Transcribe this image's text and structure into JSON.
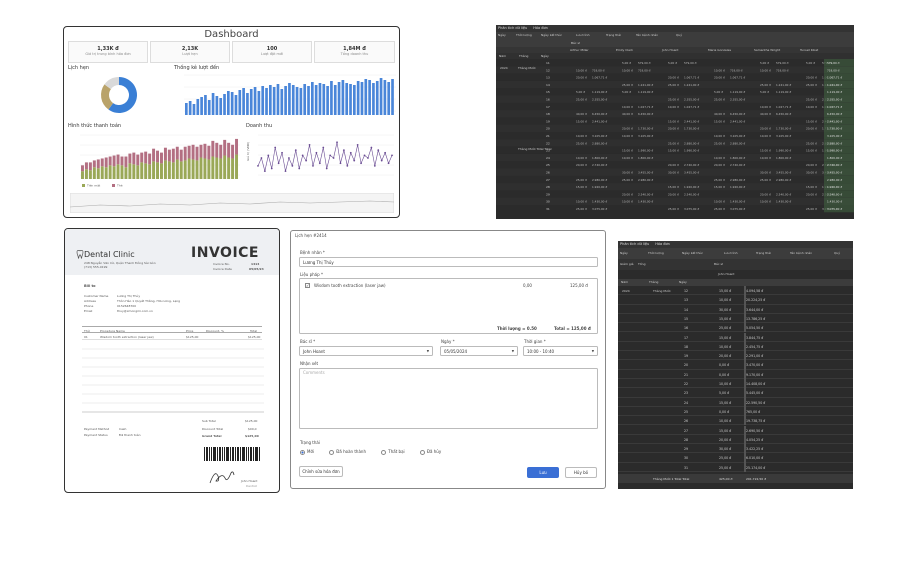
{
  "dashboard": {
    "title": "Dashboard",
    "kpis": [
      {
        "value": "1,33K đ",
        "label": "Giá trị trung bình hóa đơn"
      },
      {
        "value": "2,13K",
        "label": "Lượt hẹn"
      },
      {
        "value": "100",
        "label": "Lượt đặt mới"
      },
      {
        "value": "1,84M đ",
        "label": "Tổng doanh thu"
      }
    ],
    "panels": {
      "appointments": "Lịch hẹn",
      "stats": "Thống kê lượt đến",
      "payment": "Hình thức thanh toán",
      "revenue": "Doanh thu"
    }
  },
  "chart_data": [
    {
      "type": "pie",
      "title": "Lịch hẹn",
      "labels": [
        "",
        "",
        ""
      ],
      "values": [
        0.6,
        0.25,
        0.15
      ],
      "colors": [
        "#3a7fd5",
        "#b9a36a",
        "#d9d9d9"
      ]
    },
    {
      "type": "bar",
      "title": "Thống kê lượt đến",
      "values": [
        12,
        14,
        11,
        16,
        18,
        20,
        15,
        22,
        19,
        17,
        21,
        24,
        23,
        20,
        25,
        27,
        22,
        26,
        28,
        24,
        29,
        27,
        30,
        28,
        31,
        26,
        29,
        32,
        30,
        28,
        27,
        31,
        29,
        33,
        30,
        32,
        31,
        29,
        34,
        30,
        33,
        35,
        32,
        31,
        30,
        34,
        33,
        36,
        35,
        32,
        34,
        37,
        35,
        33,
        36
      ],
      "colors": [
        "#4a86d9"
      ]
    },
    {
      "type": "bar",
      "title": "Hình thức thanh toán",
      "series": [
        {
          "name": "Tiền mặt",
          "values": [
            8,
            10,
            9,
            12,
            11,
            13,
            12,
            14,
            13,
            15,
            14,
            12,
            16,
            15,
            14,
            17,
            16,
            15,
            18,
            17,
            16,
            19,
            18,
            17,
            20,
            18,
            19,
            21,
            20,
            19,
            22,
            21,
            20,
            23,
            22,
            21,
            24,
            22,
            21,
            25
          ]
        },
        {
          "name": "Thẻ",
          "values": [
            6,
            7,
            8,
            7,
            9,
            8,
            10,
            9,
            11,
            10,
            9,
            11,
            10,
            12,
            11,
            10,
            12,
            11,
            13,
            12,
            11,
            13,
            12,
            14,
            13,
            12,
            14,
            13,
            15,
            14,
            13,
            15,
            14,
            16,
            15,
            14,
            16,
            15,
            14,
            16
          ]
        }
      ],
      "colors": [
        "#9aa857",
        "#b36f82"
      ]
    },
    {
      "type": "line",
      "title": "Doanh thu",
      "ylabel": "Giá trị (VND)",
      "series": [
        {
          "name": "",
          "values": [
            5,
            8,
            3,
            9,
            4,
            12,
            6,
            10,
            3,
            8,
            5,
            11,
            4,
            9,
            7,
            13,
            5,
            10,
            6,
            12,
            4,
            9,
            8,
            14,
            6,
            11,
            5,
            10,
            7,
            13,
            6,
            9,
            8,
            12,
            5,
            11,
            7,
            10,
            6,
            9
          ]
        }
      ],
      "colors": [
        "#6a4c93"
      ]
    }
  ],
  "pivot1": {
    "menu": [
      "Phân tích dữ liệu",
      "Hóa đơn"
    ],
    "tabs": [
      "Ngày",
      "Thời lượng",
      "Ngày kết thúc",
      "Lưu trình",
      "Trạng thái",
      "Tên bệnh nhân",
      "Quý"
    ],
    "rowheads": [
      "Năm",
      "Tháng",
      "Ngày"
    ],
    "group": "Bác sĩ",
    "doctors": [
      "Arthur Miller",
      "Emily Clark",
      "John Hoant",
      "Maria Gonzales",
      "Samantha Wright",
      "Tunset Kikat"
    ],
    "days": [
      "11",
      "12",
      "13",
      "14",
      "15",
      "16",
      "17",
      "18",
      "19",
      "20",
      "21",
      "22",
      "23",
      "24",
      "25",
      "26",
      "27",
      "28",
      "29",
      "30",
      "31"
    ],
    "year": "2024",
    "month1": "Tháng Mười",
    "totalLabel": "Tháng Mười Total Total",
    "rows": [
      [
        "5,00 đ",
        "579,00 đ"
      ],
      [
        "10,00 đ",
        "719,00 đ"
      ],
      [
        "20,00 đ",
        "1.067,71 đ"
      ],
      [
        "25,00 đ",
        "1.241,00 đ"
      ],
      [
        "5,00 đ",
        "1.119,00 đ"
      ],
      [
        "25,00 đ",
        "2.355,00 đ"
      ],
      [
        "10,00 đ",
        "1.027,71 đ"
      ],
      [
        "40,00 đ",
        "6.450,00 đ"
      ],
      [
        "15,00 đ",
        "2.441,00 đ"
      ],
      [
        "20,00 đ",
        "1.730,00 đ"
      ],
      [
        "10,00 đ",
        "3.105,00 đ"
      ],
      [
        "25,00 đ",
        "2.880,00 đ"
      ],
      [
        "15,00 đ",
        "1.990,00 đ"
      ],
      [
        "10,00 đ",
        "1.800,00 đ"
      ],
      [
        "20,00 đ",
        "2.740,00 đ"
      ],
      [
        "30,00 đ",
        "3.455,00 đ"
      ],
      [
        "25,00 đ",
        "2.980,00 đ"
      ],
      [
        "15,00 đ",
        "1.920,00 đ"
      ],
      [
        "20,00 đ",
        "2.540,00 đ"
      ],
      [
        "10,00 đ",
        "1.430,00 đ"
      ],
      [
        "25,00 đ",
        "3.075,00 đ"
      ]
    ]
  },
  "invoice": {
    "clinic": "Dental Clinic",
    "address": "248 Nguyễn Văn Cừ, Quận Thanh Đồng Sài Gòn",
    "phone": "(713) 555-0199",
    "word": "INVOICE",
    "invoice_no_label": "Invoice No.",
    "invoice_no": "1414",
    "date_label": "Invoice Date",
    "date": "05/05/24",
    "billto": "Bill to",
    "fields": [
      [
        "Customer Name",
        "Lương Thị Thủy"
      ],
      [
        "Address",
        "Thôn Hào 1 Quyết Thắng, Hữu Lũng, Lạng"
      ],
      [
        "Phone",
        "0152648700"
      ],
      [
        "Email",
        "thuy@xmongmi.com.vn"
      ]
    ],
    "cols": [
      "Thứ",
      "Procedure Name",
      "Price",
      "Discount, %",
      "Total"
    ],
    "item": [
      "01",
      "Wisdom tooth extraction (laser jaw)",
      "$125,00",
      "",
      "$125,00"
    ],
    "sub_label": "Sub Total",
    "sub": "$125,00",
    "disc_label": "Discount Total",
    "disc": "$00,0",
    "grand_label": "Grand Total",
    "grand": "$125,00",
    "pay_method_label": "Payment Method",
    "pay_method": "Cash",
    "pay_status_label": "Payment Status",
    "pay_status": "Đã thanh toán",
    "signer": "John Hoant",
    "signer_role": "Dentist"
  },
  "dialog": {
    "title": "Lịch hẹn #2414",
    "patient_label": "Bệnh nhân *",
    "patient": "Lương Thị Thủy",
    "proc_label": "Liệu pháp *",
    "proc_name": "Wisdom tooth extraction (laser jaw)",
    "proc_disc": "0,00",
    "proc_price": "125,00 đ",
    "qty": "Thời lượng = 0.50",
    "total": "Total = 125,00 đ",
    "doctor_label": "Bác sĩ *",
    "doctor": "John Hoant",
    "date_label": "Ngày *",
    "date": "05/05/2024",
    "time_label": "Thời gian *",
    "time": "10:00 - 10:40",
    "notes_label": "Nhận xét",
    "notes_placeholder": "Comments",
    "status_label": "Trạng thái",
    "statuses": [
      "Mới",
      "Đã hoàn thành",
      "Thất bại",
      "Đã hủy"
    ],
    "edit_invoice": "Chỉnh sửa hóa đơn",
    "save": "Lưu",
    "cancel": "Hủy bỏ"
  },
  "pivot2": {
    "menu": [
      "Phân tích dữ liệu",
      "Hóa đơn"
    ],
    "tabs": [
      "Ngày",
      "Thời lượng",
      "Ngày kết thúc",
      "Lưu trình",
      "Trạng thái",
      "Tên bệnh nhân",
      "Quý"
    ],
    "measures": [
      "Giảm giá",
      "Tổng"
    ],
    "doctor_filter": "Bác sĩ",
    "doctor": "John Hoant",
    "rowheads": [
      "Năm",
      "Tháng",
      "Ngày"
    ],
    "year": "2024",
    "month": "Tháng Mười",
    "total_label": "Tháng Mười 1 Total Total",
    "rows": [
      [
        "12",
        "15,00 đ",
        "4.094,58 đ"
      ],
      [
        "13",
        "10,00 đ",
        "20.224,25 đ"
      ],
      [
        "14",
        "30,00 đ",
        "3.644,00 đ"
      ],
      [
        "15",
        "15,00 đ",
        "13.786,25 đ"
      ],
      [
        "16",
        "25,00 đ",
        "5.054,50 đ"
      ],
      [
        "17",
        "15,00 đ",
        "3.844,75 đ"
      ],
      [
        "18",
        "10,00 đ",
        "2.454,75 đ"
      ],
      [
        "19",
        "20,00 đ",
        "2.291,00 đ"
      ],
      [
        "20",
        "0,00 đ",
        "3.470,00 đ"
      ],
      [
        "21",
        "0,00 đ",
        "9.170,00 đ"
      ],
      [
        "22",
        "10,00 đ",
        "14.408,00 đ"
      ],
      [
        "23",
        "5,00 đ",
        "5.445,00 đ"
      ],
      [
        "24",
        "15,00 đ",
        "22.590,50 đ"
      ],
      [
        "25",
        "0,00 đ",
        "765,00 đ"
      ],
      [
        "26",
        "10,00 đ",
        "19.738,75 đ"
      ],
      [
        "27",
        "15,00 đ",
        "2.690,50 đ"
      ],
      [
        "28",
        "20,00 đ",
        "4.054,25 đ"
      ],
      [
        "29",
        "30,00 đ",
        "3.422,25 đ"
      ],
      [
        "30",
        "25,00 đ",
        "6.010,00 đ"
      ],
      [
        "31",
        "25,00 đ",
        "25.174,00 đ"
      ]
    ],
    "total_disc": "425,00 đ",
    "total_sum": "291.722,50 đ"
  }
}
